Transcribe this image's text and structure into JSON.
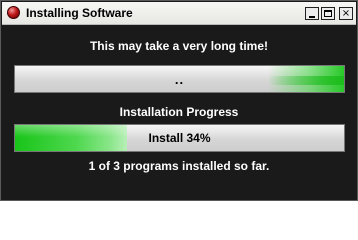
{
  "window": {
    "title": "Installing Software",
    "controls": {
      "minimize": "minimize-icon",
      "maximize": "maximize-icon",
      "close": "×"
    }
  },
  "dialog": {
    "message": "This may take a very long time!",
    "activity_bar": {
      "label": "..",
      "mode": "indeterminate"
    },
    "section_label": "Installation Progress",
    "install_bar": {
      "label": "Install 34%",
      "progress": 0.34
    },
    "status": "1 of 3 programs installed so far."
  },
  "colors": {
    "background": "#1a1a1a",
    "progress_fill": "#2ecc2e",
    "text": "#ffffff"
  }
}
